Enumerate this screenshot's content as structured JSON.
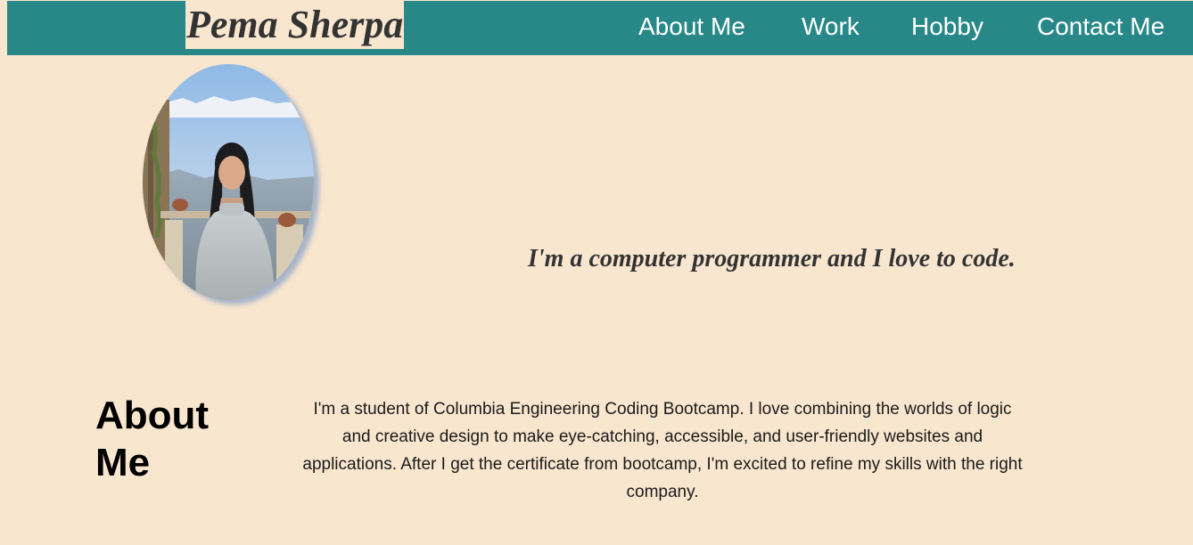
{
  "header": {
    "brand": "Pema Sherpa",
    "nav": [
      {
        "label": "About Me"
      },
      {
        "label": "Work"
      },
      {
        "label": "Hobby"
      },
      {
        "label": "Contact Me"
      }
    ]
  },
  "hero": {
    "tagline": "I'm a computer programmer and I love to code."
  },
  "about": {
    "heading": "About Me",
    "body": "I'm a student of Columbia Engineering Coding Bootcamp. I love combining the worlds of logic and creative design to make eye-catching, accessible, and user-friendly websites and applications. After I get the certificate from bootcamp, I'm excited to refine my skills with the right company."
  },
  "colors": {
    "page_background": "#f9e6cf",
    "navbar_background": "#288888",
    "nav_text": "#ffffff",
    "brand_text": "#333333"
  }
}
